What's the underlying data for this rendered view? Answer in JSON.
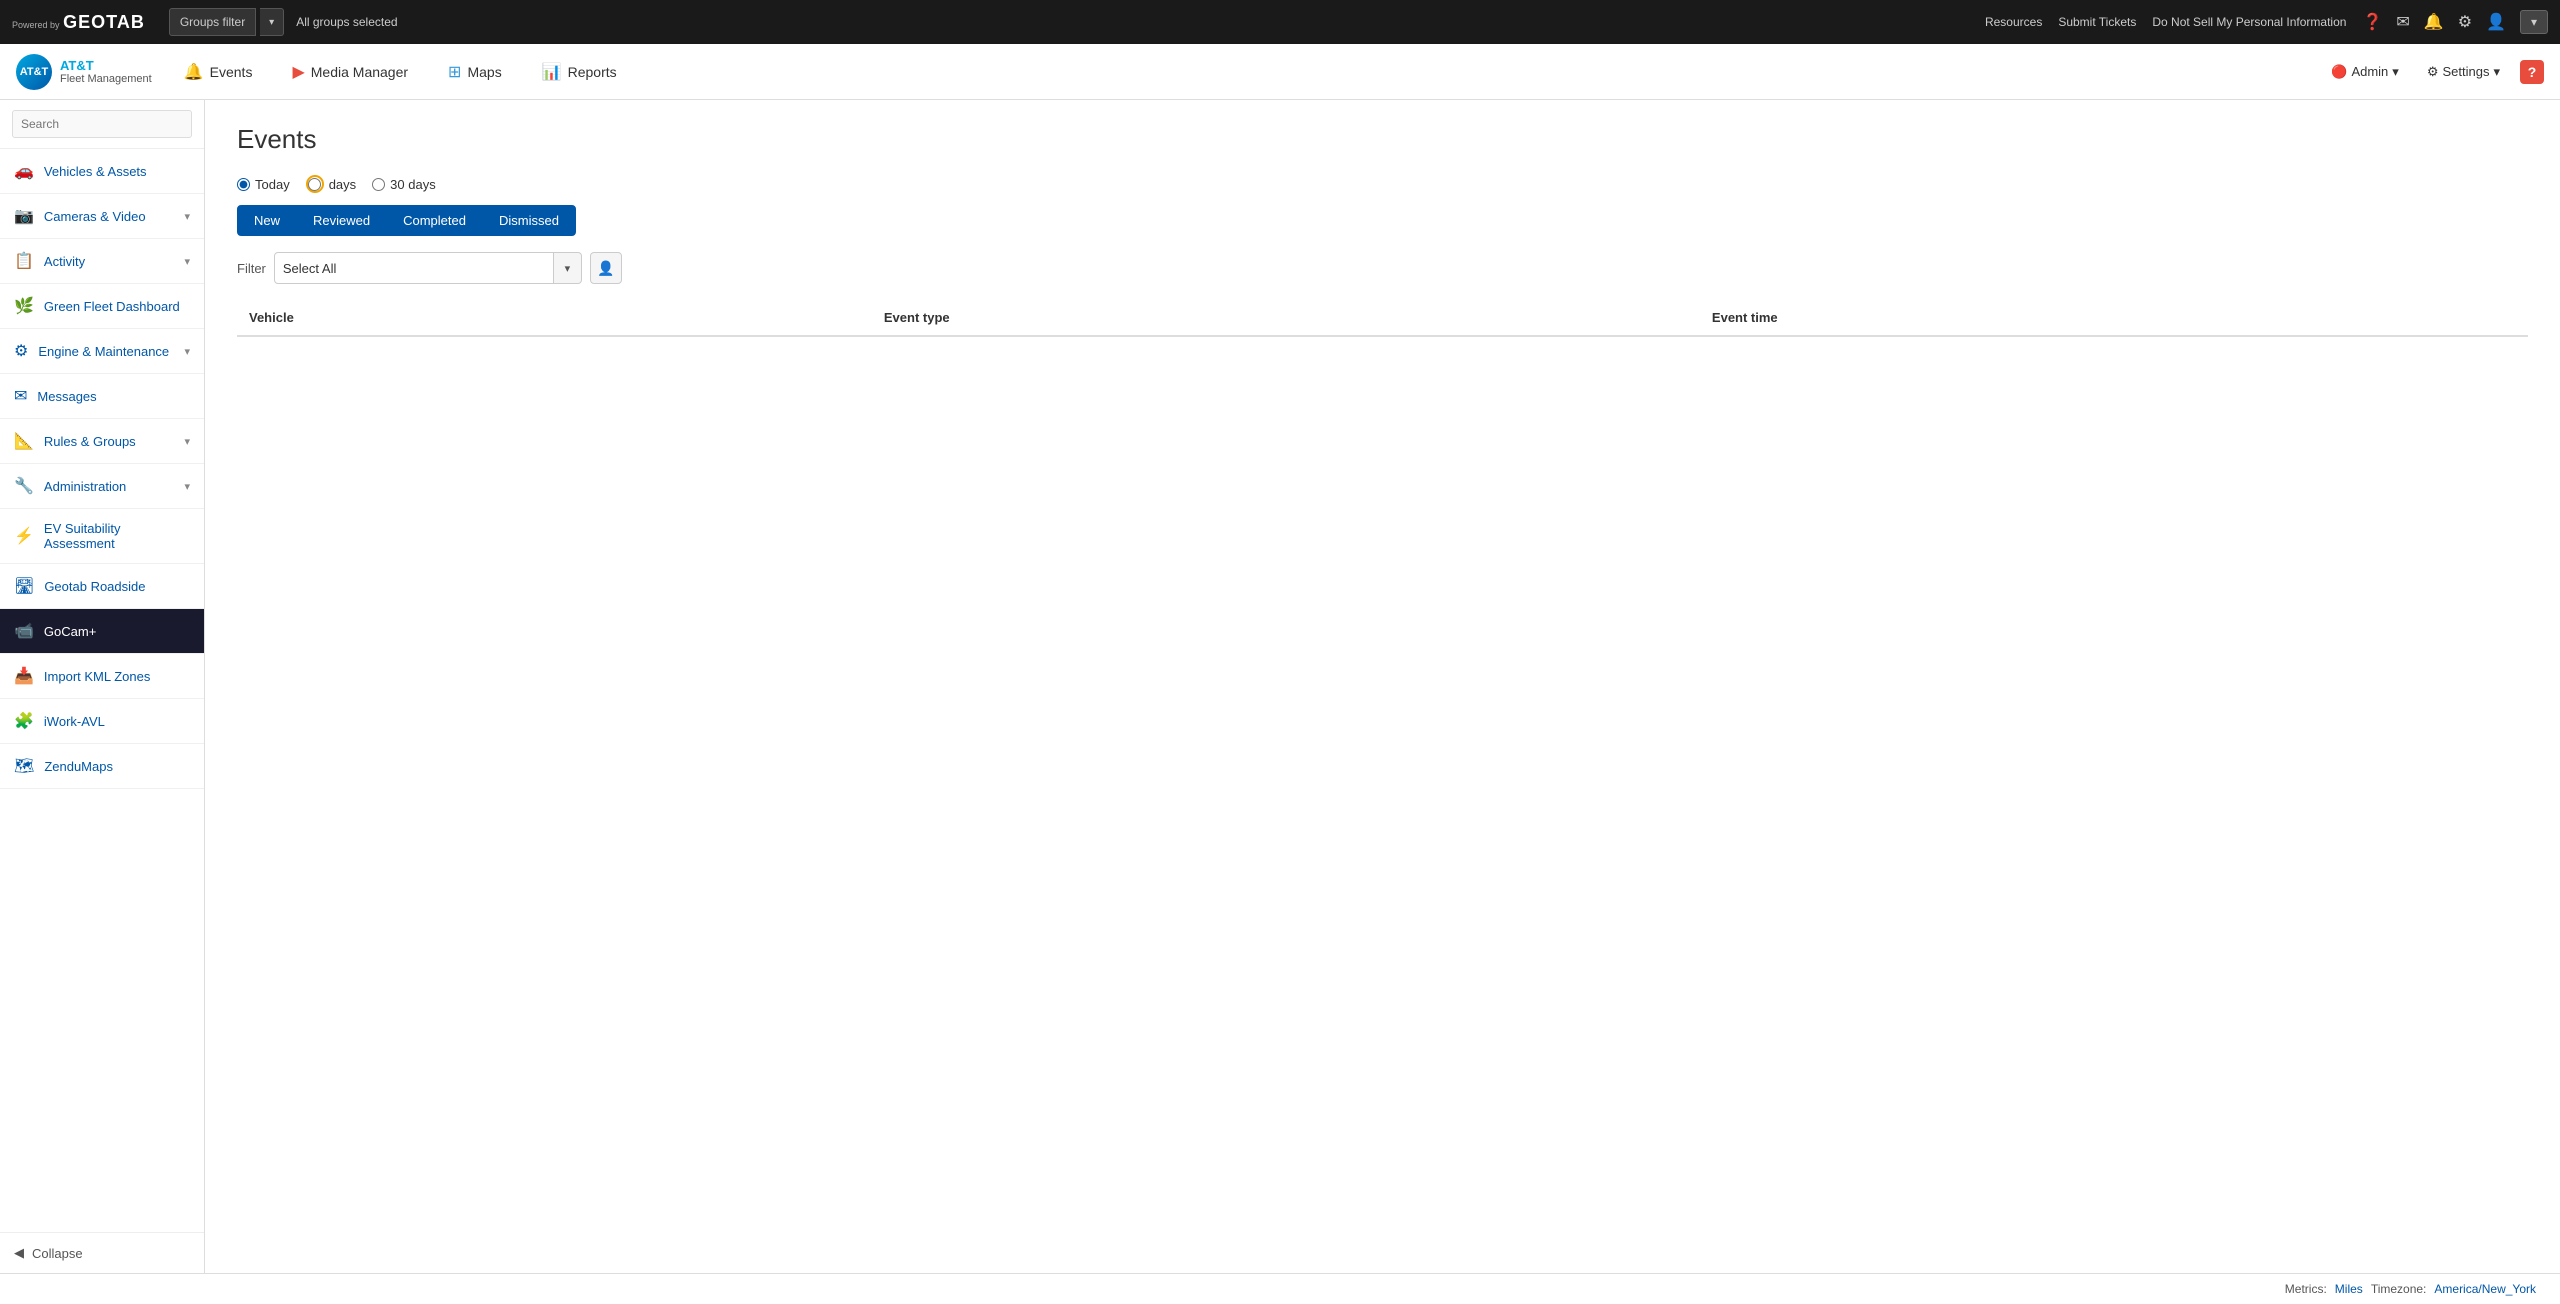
{
  "topBar": {
    "poweredBy": "Powered by",
    "logo": "GEOTAB",
    "groupsFilterLabel": "Groups filter",
    "groupsFilterValue": "All groups selected",
    "links": [
      "Resources",
      "Submit Tickets",
      "Do Not Sell My Personal Information"
    ],
    "icons": [
      "help",
      "mail",
      "bell",
      "settings",
      "user"
    ],
    "userLabel": "▾"
  },
  "secondBar": {
    "attLogoText": "AT&T",
    "attSubText": "Fleet Management",
    "navItems": [
      {
        "label": "Events",
        "icon": "🔔",
        "colorClass": "events"
      },
      {
        "label": "Media Manager",
        "icon": "▶",
        "colorClass": "media"
      },
      {
        "label": "Maps",
        "icon": "⊞",
        "colorClass": "maps"
      },
      {
        "label": "Reports",
        "icon": "📊",
        "colorClass": "reports"
      }
    ],
    "adminLabel": "Admin",
    "settingsLabel": "Settings",
    "helpLabel": "?"
  },
  "sidebar": {
    "searchPlaceholder": "Search",
    "items": [
      {
        "label": "Vehicles & Assets",
        "icon": "🚗",
        "hasArrow": false
      },
      {
        "label": "Cameras & Video",
        "icon": "📷",
        "hasArrow": true
      },
      {
        "label": "Activity",
        "icon": "📋",
        "hasArrow": true
      },
      {
        "label": "Green Fleet Dashboard",
        "icon": "🌿",
        "hasArrow": false
      },
      {
        "label": "Engine & Maintenance",
        "icon": "⚙",
        "hasArrow": true
      },
      {
        "label": "Messages",
        "icon": "✉",
        "hasArrow": false
      },
      {
        "label": "Rules & Groups",
        "icon": "📐",
        "hasArrow": true
      },
      {
        "label": "Administration",
        "icon": "🔧",
        "hasArrow": true
      },
      {
        "label": "EV Suitability Assessment",
        "icon": "⚡",
        "hasArrow": false
      },
      {
        "label": "Geotab Roadside",
        "icon": "🛣",
        "hasArrow": false
      },
      {
        "label": "GoCam+",
        "icon": "📹",
        "hasArrow": false,
        "isGoCam": true
      },
      {
        "label": "Import KML Zones",
        "icon": "📥",
        "hasArrow": false
      },
      {
        "label": "iWork-AVL",
        "icon": "🧩",
        "hasArrow": false
      },
      {
        "label": "ZenduMaps",
        "icon": "🗺",
        "hasArrow": false
      }
    ],
    "collapseLabel": "Collapse"
  },
  "content": {
    "pageTitle": "Events",
    "radioOptions": [
      {
        "label": "Today",
        "value": "today",
        "checked": true
      },
      {
        "label": "days",
        "value": "days",
        "checked": false
      },
      {
        "label": "30 days",
        "value": "30days",
        "checked": false
      }
    ],
    "tabs": [
      {
        "label": "New",
        "active": true
      },
      {
        "label": "Reviewed",
        "active": true
      },
      {
        "label": "Completed",
        "active": true
      },
      {
        "label": "Dismissed",
        "active": true
      }
    ],
    "filterLabel": "Filter",
    "filterValue": "Select All",
    "tableColumns": [
      "Vehicle",
      "Event type",
      "Event time"
    ]
  },
  "footer": {
    "metricsLabel": "Metrics:",
    "metricsValue": "Miles",
    "timezoneLabel": "Timezone:",
    "timezoneValue": "America/New_York"
  }
}
